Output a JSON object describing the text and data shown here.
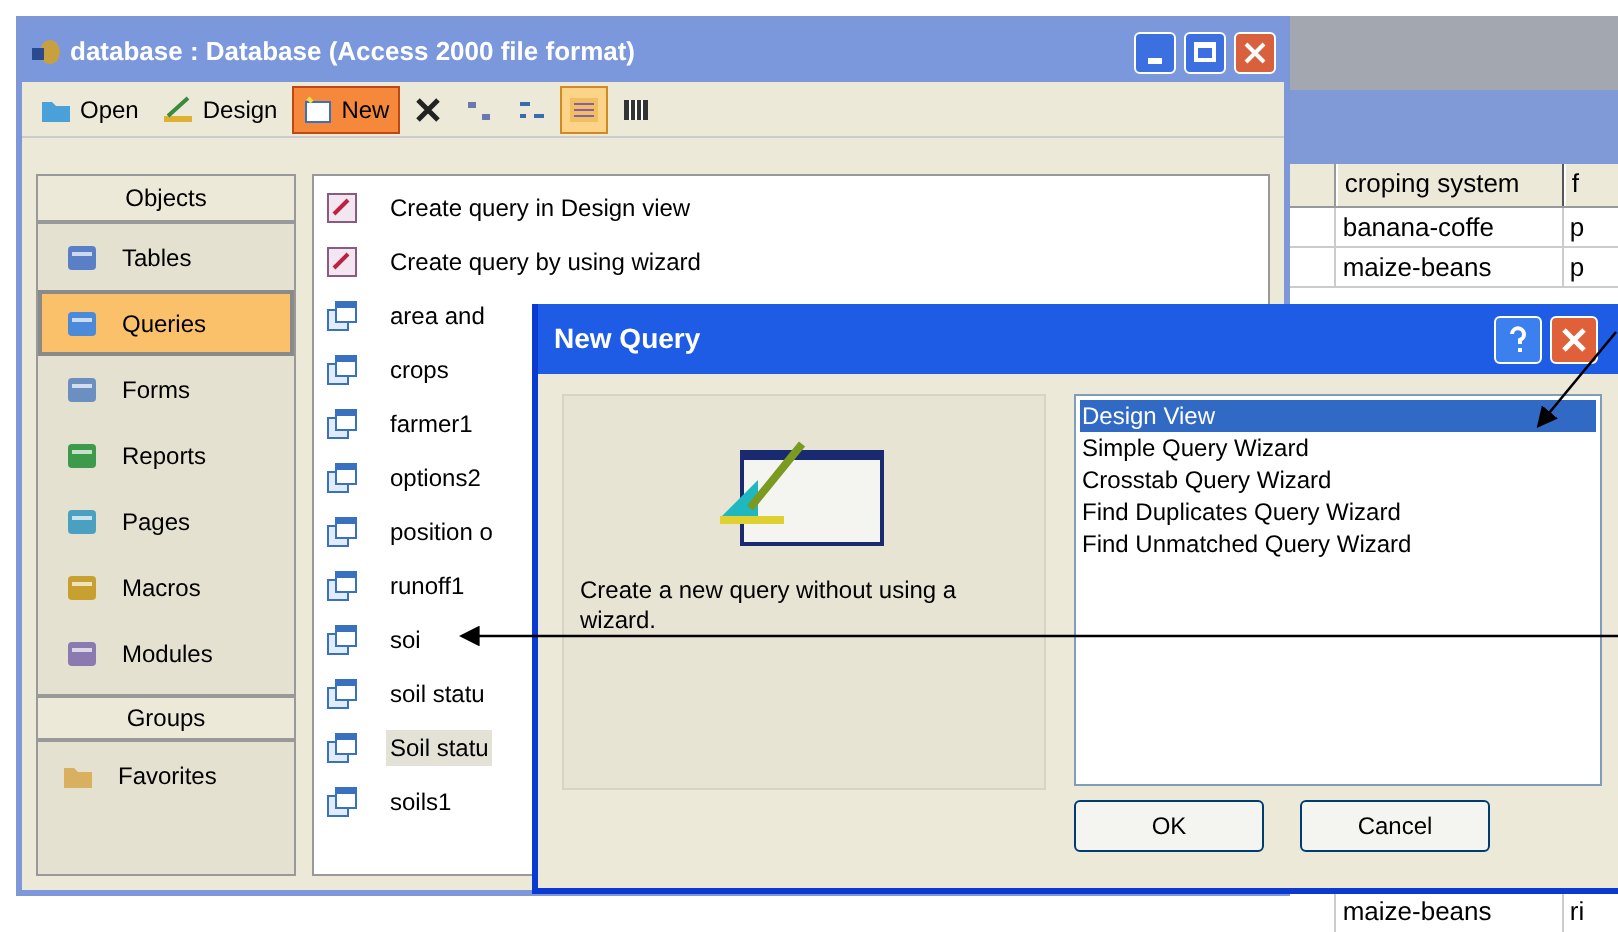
{
  "database_window": {
    "title": "database : Database (Access 2000 file format)",
    "toolbar": [
      {
        "kind": "open",
        "label": "Open",
        "selected": false
      },
      {
        "kind": "design",
        "label": "Design",
        "selected": false
      },
      {
        "kind": "new",
        "label": "New",
        "selected": true
      },
      {
        "kind": "delete",
        "selected": false
      },
      {
        "kind": "large-icons",
        "selected": false
      },
      {
        "kind": "small-icons",
        "selected": false
      },
      {
        "kind": "list",
        "selected": true
      },
      {
        "kind": "details",
        "selected": false
      }
    ],
    "objects_header": "Objects",
    "objects": [
      {
        "kind": "table",
        "label": "Tables",
        "selected": false
      },
      {
        "kind": "query",
        "label": "Queries",
        "selected": true
      },
      {
        "kind": "form",
        "label": "Forms",
        "selected": false
      },
      {
        "kind": "report",
        "label": "Reports",
        "selected": false
      },
      {
        "kind": "page",
        "label": "Pages",
        "selected": false
      },
      {
        "kind": "macro",
        "label": "Macros",
        "selected": false
      },
      {
        "kind": "module",
        "label": "Modules",
        "selected": false
      }
    ],
    "groups_header": "Groups",
    "groups": [
      {
        "label": "Favorites",
        "selected": false
      }
    ],
    "items": [
      {
        "kind": "create",
        "label": "Create query in Design view",
        "selected": false
      },
      {
        "kind": "create",
        "label": "Create query by using wizard",
        "selected": false
      },
      {
        "kind": "query",
        "label": "area and",
        "selected": false
      },
      {
        "kind": "query",
        "label": "crops",
        "selected": false
      },
      {
        "kind": "query",
        "label": "farmer1",
        "selected": false
      },
      {
        "kind": "query",
        "label": "options2",
        "selected": false
      },
      {
        "kind": "query",
        "label": "position o",
        "selected": false
      },
      {
        "kind": "query",
        "label": "runoff1",
        "selected": false
      },
      {
        "kind": "query",
        "label": "soi",
        "selected": false
      },
      {
        "kind": "query",
        "label": "soil statu",
        "selected": false
      },
      {
        "kind": "query",
        "label": "Soil statu",
        "selected": true
      },
      {
        "kind": "query",
        "label": "soils1",
        "selected": false
      }
    ]
  },
  "table_window": {
    "columns": [
      "croping system",
      "f"
    ],
    "rows": [
      [
        "banana-coffe",
        "p"
      ],
      [
        "maize-beans",
        "p"
      ]
    ],
    "bottom_row": [
      "maize-beans",
      "ri"
    ]
  },
  "dialog": {
    "title": "New Query",
    "description": "Create a new query without using a wizard.",
    "options": [
      {
        "label": "Design View",
        "selected": true
      },
      {
        "label": "Simple Query Wizard",
        "selected": false
      },
      {
        "label": "Crosstab Query Wizard",
        "selected": false
      },
      {
        "label": "Find Duplicates Query Wizard",
        "selected": false
      },
      {
        "label": "Find Unmatched Query Wizard",
        "selected": false
      }
    ],
    "buttons": [
      "OK",
      "Cancel"
    ]
  }
}
